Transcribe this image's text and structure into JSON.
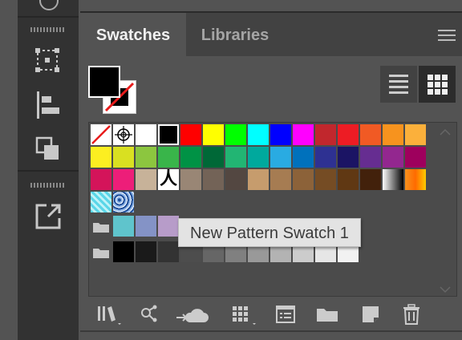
{
  "panel": {
    "tabs": [
      {
        "label": "Swatches",
        "active": true
      },
      {
        "label": "Libraries",
        "active": false
      }
    ]
  },
  "tooltip": "New Pattern Swatch 1",
  "swatch_rows": [
    [
      "none",
      "registration",
      "#ffffff",
      "#000000",
      "#ff0000",
      "#ffff00",
      "#00ff00",
      "#00ffff",
      "#0000ff",
      "#ff00ff",
      "#c1272d",
      "#ed1c24",
      "#f15a24",
      "#f7931e",
      "#fbb03b"
    ],
    [
      "#fcee21",
      "#d9e021",
      "#8cc63f",
      "#39b54a",
      "#009245",
      "#006837",
      "#22b573",
      "#00a99d",
      "#29abe2",
      "#0071bc",
      "#2e3192",
      "#1b1464",
      "#662d91",
      "#93278f",
      "#9e005d"
    ],
    [
      "#d4145a",
      "#ed1e79",
      "#c7b299",
      "char",
      "#998675",
      "#736357",
      "#534741",
      "#c69c6d",
      "#a67c52",
      "#8c6239",
      "#754c24",
      "#603813",
      "#42210b",
      "gradient-bw",
      "gradient-orange"
    ],
    [
      "pattern-blue",
      "pattern-waves"
    ]
  ],
  "group1_swatches": [
    "#5fc4cc",
    "#8493c6",
    "#b79cc9"
  ],
  "group2_swatches": [
    "#000000",
    "#1a1a1a",
    "#333333",
    "#4d4d4d",
    "#666666",
    "#808080",
    "#999999",
    "#b3b3b3",
    "#cccccc",
    "#e6e6e6",
    "#f2f2f2"
  ],
  "char_swatch_glyph": "人",
  "icons": {
    "tools": [
      "align-icon",
      "pathfinder-icon",
      "transform-icon",
      "export-icon"
    ],
    "bottom": [
      "libraries-menu-icon",
      "place-icon",
      "cloud-icon",
      "show-kinds-icon",
      "swatch-options-icon",
      "new-group-icon",
      "new-swatch-icon",
      "delete-icon"
    ]
  },
  "colors": {
    "panel_bg": "#535353",
    "tab_bar_bg": "#424242",
    "toolbar_bg": "#323232",
    "tooltip_bg": "#e3e3e3"
  }
}
